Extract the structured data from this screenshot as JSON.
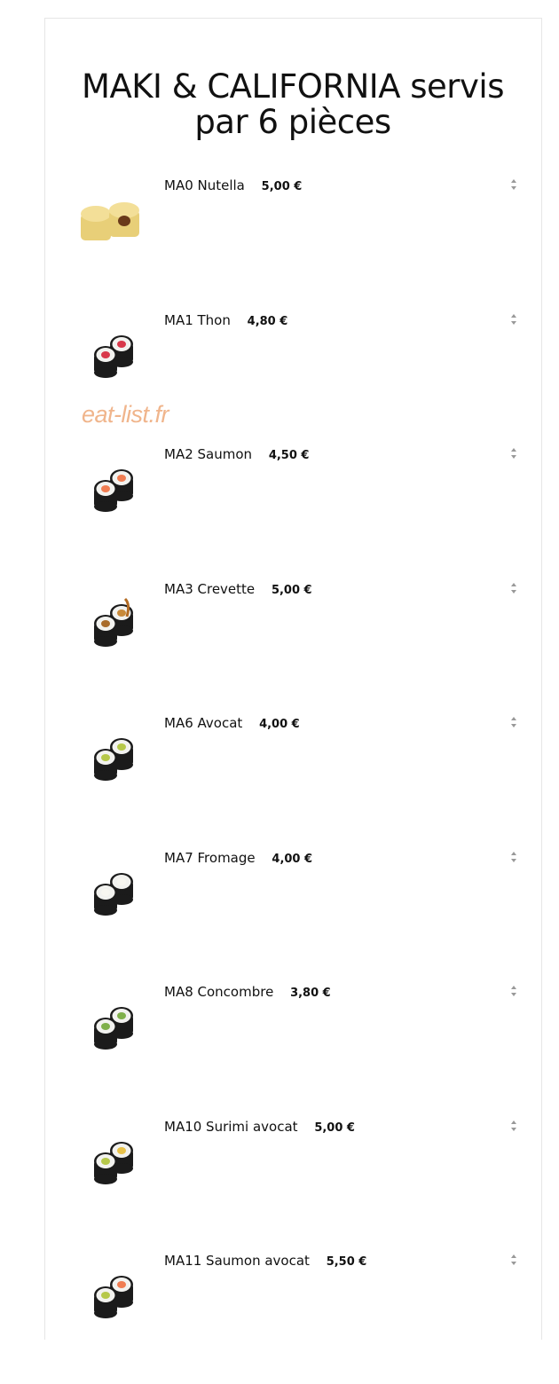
{
  "header": {
    "title_line1": "MAKI & CALIFORNIA servis",
    "title_line2": "par 6 pièces"
  },
  "watermark": "eat-list.fr",
  "items": [
    {
      "name": "MA0 Nutella",
      "price": "5,00 €",
      "image": "nutella-roll"
    },
    {
      "name": "MA1 Thon",
      "price": "4,80 €",
      "image": "tuna-maki"
    },
    {
      "name": "MA2 Saumon",
      "price": "4,50 €",
      "image": "salmon-maki"
    },
    {
      "name": "MA3 Crevette",
      "price": "5,00 €",
      "image": "shrimp-maki"
    },
    {
      "name": "MA6 Avocat",
      "price": "4,00 €",
      "image": "avocado-maki"
    },
    {
      "name": "MA7 Fromage",
      "price": "4,00 €",
      "image": "cheese-maki"
    },
    {
      "name": "MA8 Concombre",
      "price": "3,80 €",
      "image": "cucumber-maki"
    },
    {
      "name": "MA10 Surimi avocat",
      "price": "5,00 €",
      "image": "surimi-avocado-maki"
    },
    {
      "name": "MA11 Saumon avocat",
      "price": "5,50 €",
      "image": "salmon-avocado-maki"
    }
  ],
  "colors": {
    "nori": "#1b1b1b",
    "rice": "#f2f2ef",
    "tuna": "#d8384a",
    "salmon": "#f07d52",
    "avocado": "#b6c84a",
    "cucumber": "#7fb04a",
    "cheese": "#f7f6f0",
    "shrimp": "#c88a3a",
    "nutella": "#e8cf78",
    "watermark": "#f0b58c"
  }
}
